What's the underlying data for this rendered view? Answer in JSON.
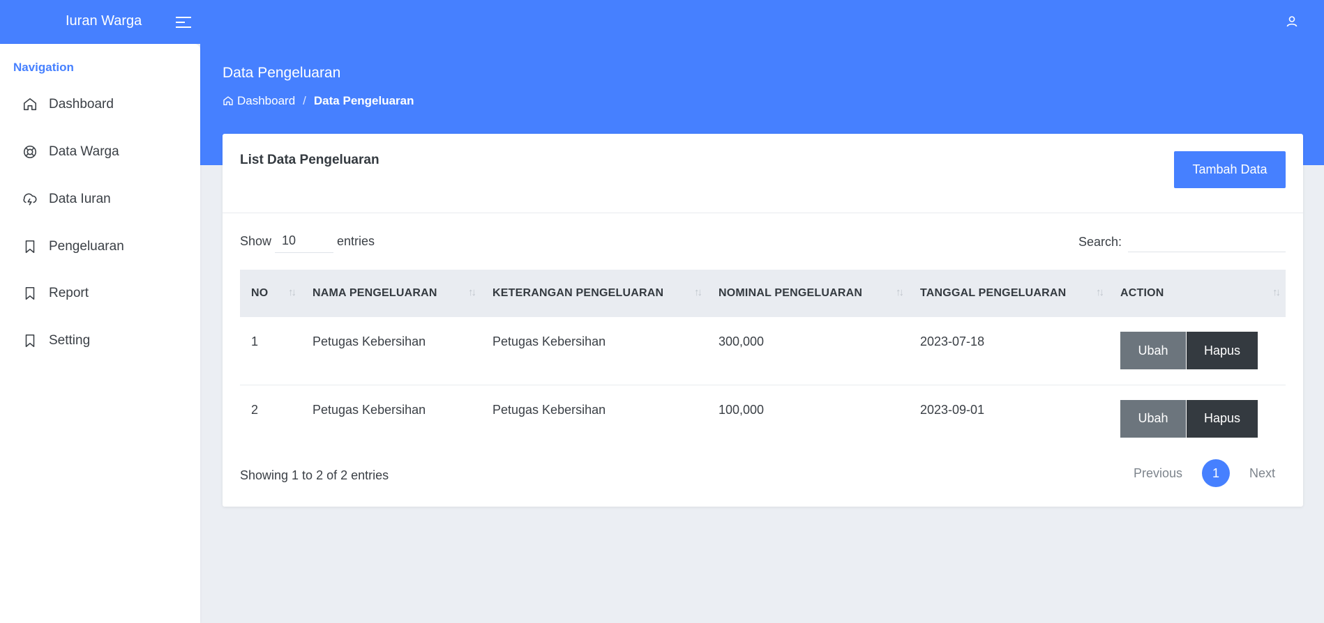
{
  "app": {
    "brand": "Iuran Warga"
  },
  "sidebar": {
    "caption": "Navigation",
    "items": [
      {
        "label": "Dashboard",
        "icon": "home-icon"
      },
      {
        "label": "Data Warga",
        "icon": "lifebuoy-icon"
      },
      {
        "label": "Data Iuran",
        "icon": "cloud-lightning-icon"
      },
      {
        "label": "Pengeluaran",
        "icon": "bookmark-icon"
      },
      {
        "label": "Report",
        "icon": "bookmark-icon"
      },
      {
        "label": "Setting",
        "icon": "bookmark-icon"
      }
    ]
  },
  "page": {
    "title": "Data Pengeluaran",
    "breadcrumb": {
      "home": "Dashboard",
      "separator": "/",
      "current": "Data Pengeluaran"
    }
  },
  "card": {
    "title": "List Data Pengeluaran",
    "add_button": "Tambah Data"
  },
  "table_controls": {
    "show_label": "Show",
    "entries_value": "10",
    "entries_label": "entries",
    "search_label": "Search:",
    "search_value": ""
  },
  "table": {
    "headers": [
      "NO",
      "NAMA PENGELUARAN",
      "KETERANGAN PENGELUARAN",
      "NOMINAL PENGELUARAN",
      "TANGGAL PENGELUARAN",
      "ACTION"
    ],
    "rows": [
      {
        "no": "1",
        "nama": "Petugas Kebersihan",
        "keterangan": "Petugas Kebersihan",
        "nominal": "300,000",
        "tanggal": "2023-07-18"
      },
      {
        "no": "2",
        "nama": "Petugas Kebersihan",
        "keterangan": "Petugas Kebersihan",
        "nominal": "100,000",
        "tanggal": "2023-09-01"
      }
    ],
    "edit_label": "Ubah",
    "delete_label": "Hapus"
  },
  "footer": {
    "info": "Showing 1 to 2 of 2 entries",
    "previous": "Previous",
    "page": "1",
    "next": "Next"
  },
  "colors": {
    "primary": "#4680ff",
    "secondary": "#6c757d",
    "dark": "#343a40",
    "background": "#ebeef3"
  }
}
